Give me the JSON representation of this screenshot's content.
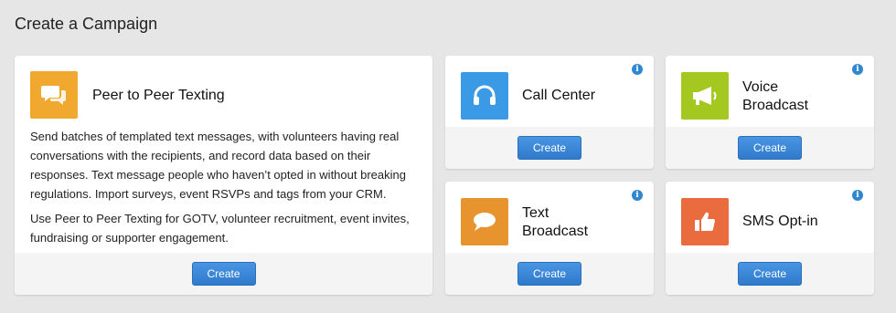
{
  "page": {
    "title": "Create a Campaign"
  },
  "colors": {
    "peer_to_peer": "#f0a92e",
    "call_center": "#3b9ae6",
    "voice_broadcast": "#a4c820",
    "text_broadcast": "#e8942e",
    "sms_optin": "#ea6b3d",
    "button": "#3a86d8",
    "info": "#2f87cf"
  },
  "cards": {
    "peer_to_peer": {
      "title": "Peer to Peer Texting",
      "icon": "chat-bubbles-icon",
      "description": [
        "Send batches of templated text messages, with volunteers having real conversations with the recipients, and record data based on their responses. Text message people who haven’t opted in without breaking regulations. Import surveys, event RSVPs and tags from your CRM.",
        "Use Peer to Peer Texting for GOTV, volunteer recruitment, event invites, fundraising or supporter engagement."
      ],
      "button": "Create"
    },
    "call_center": {
      "title": "Call Center",
      "icon": "headset-icon",
      "button": "Create",
      "info": "i"
    },
    "voice_broadcast": {
      "title_line1": "Voice",
      "title_line2": "Broadcast",
      "icon": "megaphone-icon",
      "button": "Create",
      "info": "i"
    },
    "text_broadcast": {
      "title_line1": "Text",
      "title_line2": "Broadcast",
      "icon": "speech-bubble-icon",
      "button": "Create",
      "info": "i"
    },
    "sms_optin": {
      "title": "SMS Opt-in",
      "icon": "thumbs-up-icon",
      "button": "Create",
      "info": "i"
    }
  }
}
